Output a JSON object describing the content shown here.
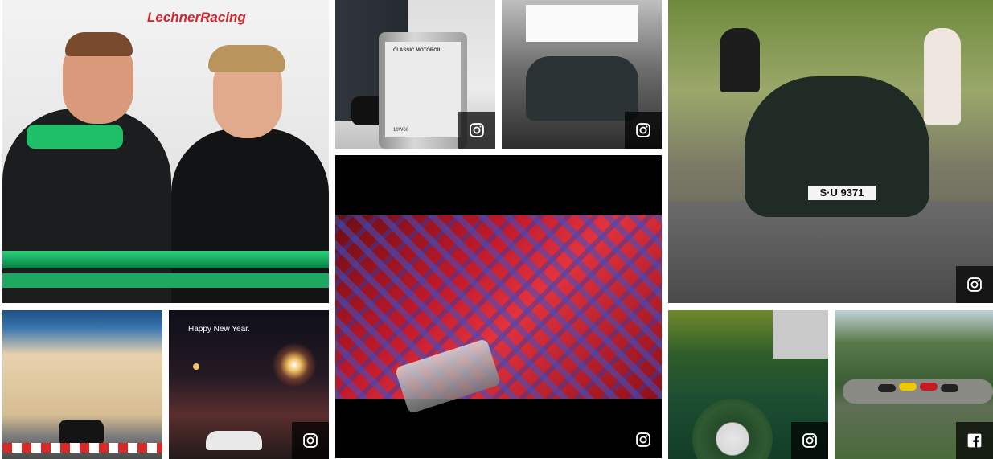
{
  "wall": {
    "tiles": [
      {
        "id": "team-portrait",
        "source": "instagram",
        "icon": "instagram-icon",
        "text_banner": "LechnerRacing"
      },
      {
        "id": "classic-motoroil",
        "source": "instagram",
        "icon": "instagram-icon",
        "product_text": "CLASSIC MOTOROIL",
        "product_grade": "10W60"
      },
      {
        "id": "showroom-covered-car",
        "source": "instagram",
        "icon": "instagram-icon"
      },
      {
        "id": "classic-911-couple",
        "source": "instagram",
        "icon": "instagram-icon",
        "plate": "S·U 9371"
      },
      {
        "id": "tartan-seat-video",
        "source": "instagram",
        "icon": "instagram-icon"
      },
      {
        "id": "race-track-building",
        "source": "none"
      },
      {
        "id": "happy-new-year",
        "source": "instagram",
        "icon": "instagram-icon",
        "caption": "Happy New Year."
      },
      {
        "id": "green-car-wreath",
        "source": "instagram",
        "icon": "instagram-icon"
      },
      {
        "id": "mountain-road-cars",
        "source": "facebook",
        "icon": "facebook-icon"
      }
    ]
  },
  "colors": {
    "badge_bg": "#000000",
    "icon_fg": "#ffffff"
  }
}
